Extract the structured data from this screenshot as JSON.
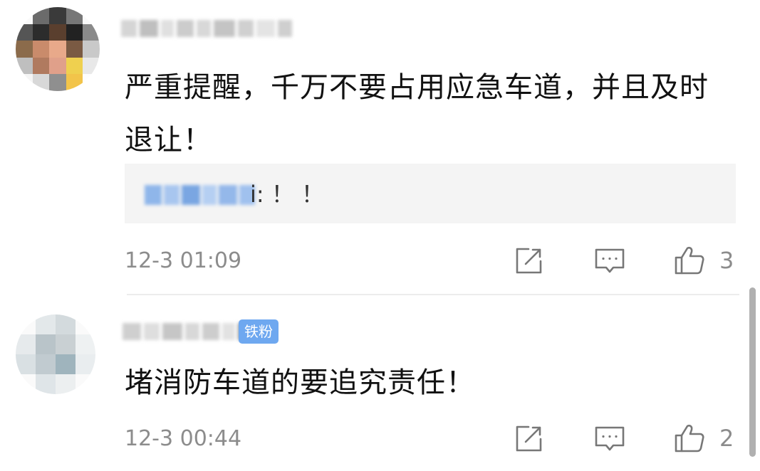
{
  "colors": {
    "text": "#111111",
    "meta": "#8c8c8c",
    "badge": "#6ea8f0",
    "reply_bg": "#f4f4f4"
  },
  "comments": [
    {
      "text": "严重提醒，千万不要占用应急车道，并且及时退让！",
      "reply_text": "i: ！ ！",
      "time": "12-3 01:09",
      "likes": "3",
      "icons": [
        "share-icon",
        "comment-icon",
        "like-icon"
      ]
    },
    {
      "badge": "铁粉",
      "text": "堵消防车道的要追究责任！",
      "time": "12-3 00:44",
      "likes": "2",
      "icons": [
        "share-icon",
        "comment-icon",
        "like-icon"
      ]
    }
  ]
}
